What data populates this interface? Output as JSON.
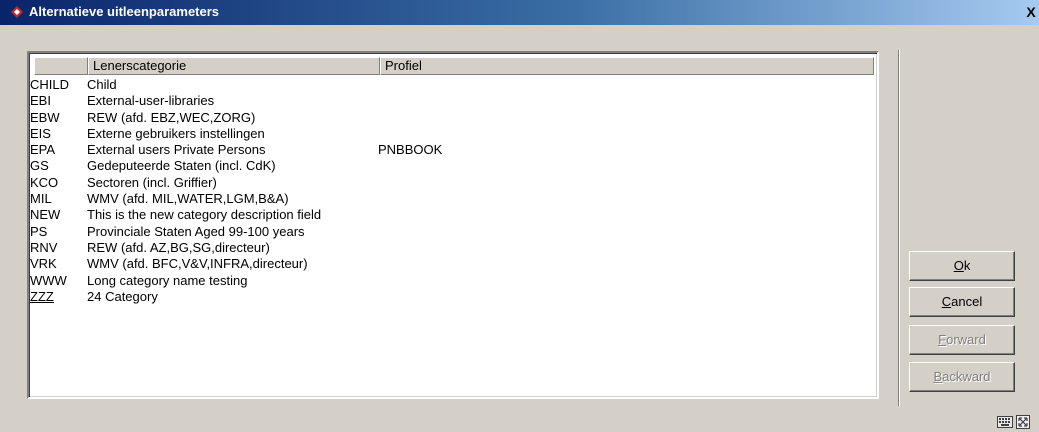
{
  "window": {
    "title": "Alternatieve uitleenparameters",
    "close_glyph": "X",
    "title_icon": "app-diamond-icon"
  },
  "list": {
    "columns": [
      "",
      "Lenerscategorie",
      "Profiel"
    ],
    "rows": [
      {
        "code": "CHILD",
        "description": "Child",
        "profile": ""
      },
      {
        "code": "EBI",
        "description": "External-user-libraries",
        "profile": ""
      },
      {
        "code": "EBW",
        "description": "REW (afd. EBZ,WEC,ZORG)",
        "profile": ""
      },
      {
        "code": "EIS",
        "description": "Externe gebruikers instellingen",
        "profile": ""
      },
      {
        "code": "EPA",
        "description": "External users Private Persons",
        "profile": "PNBBOOK"
      },
      {
        "code": "GS",
        "description": "Gedeputeerde Staten (incl. CdK)",
        "profile": ""
      },
      {
        "code": "KCO",
        "description": "Sectoren (incl. Griffier)",
        "profile": ""
      },
      {
        "code": "MIL",
        "description": "WMV (afd. MIL,WATER,LGM,B&A)",
        "profile": ""
      },
      {
        "code": "NEW",
        "description": "This is the new category description field",
        "profile": ""
      },
      {
        "code": "PS",
        "description": "Provinciale Staten Aged 99-100 years",
        "profile": ""
      },
      {
        "code": "RNV",
        "description": "REW (afd. AZ,BG,SG,directeur)",
        "profile": ""
      },
      {
        "code": "VRK",
        "description": "WMV (afd. BFC,V&V,INFRA,directeur)",
        "profile": ""
      },
      {
        "code": "WWW",
        "description": "Long category name testing",
        "profile": ""
      },
      {
        "code": "ZZZ",
        "description": "24 Category",
        "profile": ""
      }
    ]
  },
  "buttons": {
    "ok": {
      "accel": "O",
      "rest": "k",
      "enabled": true
    },
    "cancel": {
      "accel": "C",
      "rest": "ancel",
      "enabled": true
    },
    "forward": {
      "accel": "F",
      "rest": "orward",
      "enabled": false
    },
    "backward": {
      "accel": "B",
      "rest": "ackward",
      "enabled": false
    }
  },
  "status_icons": [
    "keyboard-icon",
    "resize-grip-icon"
  ],
  "colors": {
    "titlebar_start": "#0a246a",
    "titlebar_end": "#a6caf0",
    "face": "#d4d0c8",
    "icon_red": "#c0282d"
  }
}
